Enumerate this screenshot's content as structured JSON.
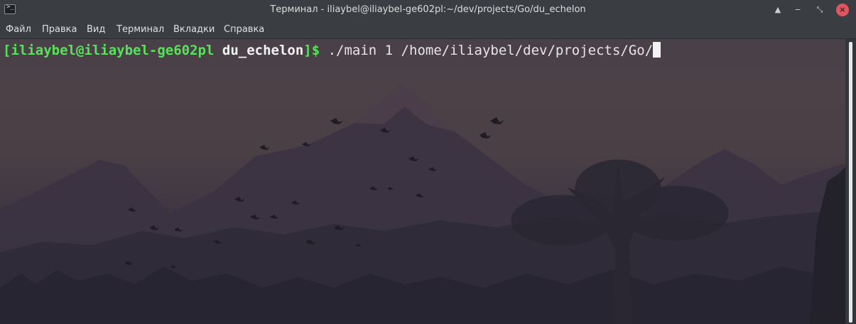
{
  "window": {
    "title": "Терминал - iliaybel@iliaybel-ge602pl:~/dev/projects/Go/du_echelon",
    "app_icon_glyph": ">_",
    "buttons": {
      "keep_above_icon": "▲",
      "minimize_icon": "−",
      "maximize_icon": "⤡",
      "close_icon": "×"
    },
    "close_color": "#e0555f"
  },
  "menubar": {
    "items": [
      "Файл",
      "Правка",
      "Вид",
      "Терминал",
      "Вкладки",
      "Справка"
    ]
  },
  "terminal": {
    "prompt_user": "[iliaybel@iliaybel-ge602pl",
    "prompt_dir": "du_echelon",
    "prompt_end": "]$",
    "command": "./main 1 /home/iliaybel/dev/projects/Go/",
    "prompt_color": "#55e35a"
  }
}
